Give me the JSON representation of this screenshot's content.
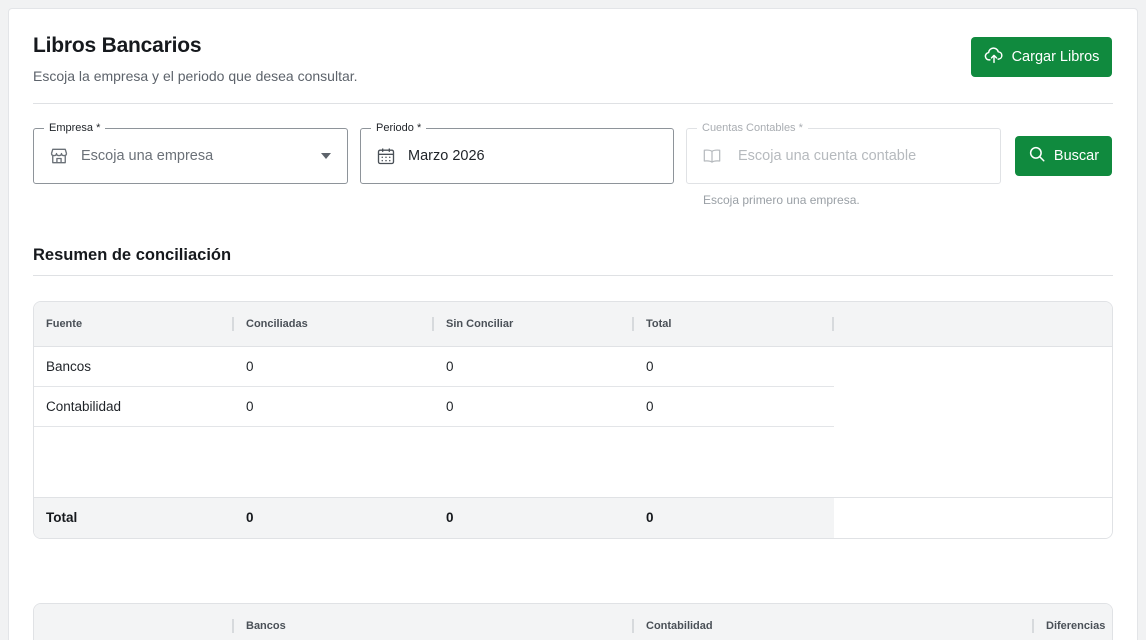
{
  "header": {
    "title": "Libros Bancarios",
    "subtitle": "Escoja la empresa y el periodo que desea consultar.",
    "load_button": "Cargar Libros"
  },
  "filters": {
    "empresa": {
      "label": "Empresa",
      "required": "*",
      "placeholder": "Escoja una empresa"
    },
    "periodo": {
      "label": "Periodo",
      "required": "*",
      "value": "Marzo 2026"
    },
    "cuentas": {
      "label": "Cuentas Contables",
      "required": "*",
      "placeholder": "Escoja una cuenta contable",
      "helper": "Escoja primero una empresa."
    },
    "search_button": "Buscar"
  },
  "summary": {
    "title": "Resumen de conciliación",
    "columns": [
      "Fuente",
      "Conciliadas",
      "Sin Conciliar",
      "Total"
    ],
    "rows": [
      [
        "Bancos",
        "0",
        "0",
        "0"
      ],
      [
        "Contabilidad",
        "0",
        "0",
        "0"
      ]
    ],
    "total": [
      "Total",
      "0",
      "0",
      "0"
    ]
  },
  "second_table": {
    "columns": [
      "",
      "Bancos",
      "Contabilidad",
      "Diferencias"
    ]
  },
  "colors": {
    "primary": "#108a3e",
    "header_bg": "#f3f4f5",
    "border": "#e0e2e5"
  }
}
